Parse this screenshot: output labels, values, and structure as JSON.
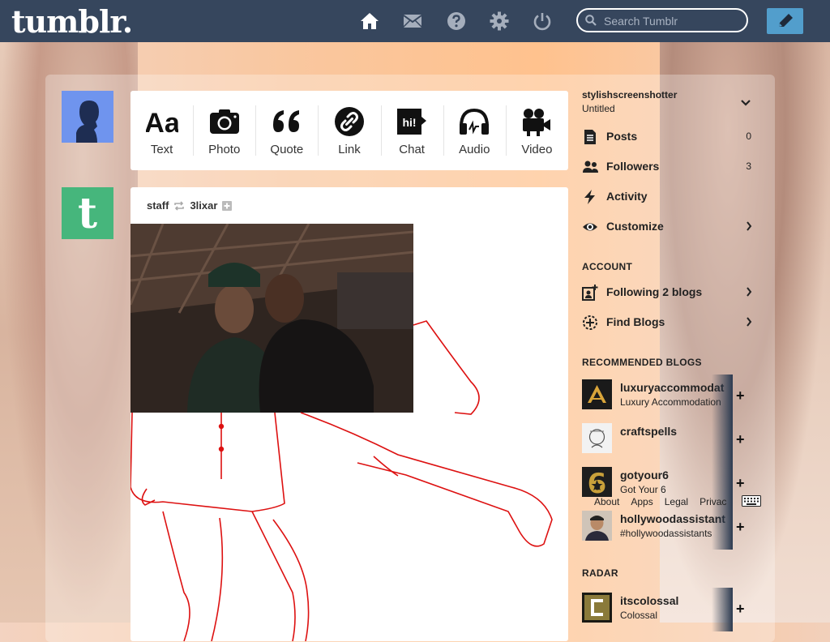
{
  "brand": {
    "logo": "tumblr.",
    "nav_color": "#36465d",
    "compose_color": "#529ecc"
  },
  "nav": {
    "icons": [
      "home-icon",
      "mail-icon",
      "help-icon",
      "gear-icon",
      "power-icon"
    ],
    "search_placeholder": "Search Tumblr"
  },
  "post_types": [
    {
      "label": "Text",
      "icon": "text-icon"
    },
    {
      "label": "Photo",
      "icon": "camera-icon"
    },
    {
      "label": "Quote",
      "icon": "quote-icon"
    },
    {
      "label": "Link",
      "icon": "link-icon"
    },
    {
      "label": "Chat",
      "icon": "chat-icon"
    },
    {
      "label": "Audio",
      "icon": "headphones-icon"
    },
    {
      "label": "Video",
      "icon": "video-camera-icon"
    }
  ],
  "post": {
    "author": "staff",
    "reblogged_from": "3lixar"
  },
  "account": {
    "name": "stylishscreenshotter",
    "subtitle": "Untitled",
    "items": [
      {
        "label": "Posts",
        "count": "0",
        "icon": "posts-icon"
      },
      {
        "label": "Followers",
        "count": "3",
        "icon": "followers-icon"
      },
      {
        "label": "Activity",
        "count": "",
        "icon": "activity-icon"
      },
      {
        "label": "Customize",
        "count": "",
        "icon": "eye-icon"
      }
    ]
  },
  "account_section": {
    "heading": "ACCOUNT",
    "items": [
      {
        "label": "Following 2 blogs",
        "icon": "following-icon"
      },
      {
        "label": "Find Blogs",
        "icon": "find-blogs-icon"
      }
    ]
  },
  "recommended": {
    "heading": "RECOMMENDED BLOGS",
    "blogs": [
      {
        "name": "luxuryaccommodat",
        "subtitle": "Luxury Accommodation"
      },
      {
        "name": "craftspells",
        "subtitle": ""
      },
      {
        "name": "gotyour6",
        "subtitle": "Got Your 6"
      },
      {
        "name": "hollywoodassistant",
        "subtitle": "#hollywoodassistants"
      }
    ]
  },
  "footer": {
    "links": [
      "About",
      "Apps",
      "Legal",
      "Privac"
    ]
  },
  "radar": {
    "heading": "RADAR",
    "blog": {
      "name": "itscolossal",
      "subtitle": "Colossal"
    }
  }
}
